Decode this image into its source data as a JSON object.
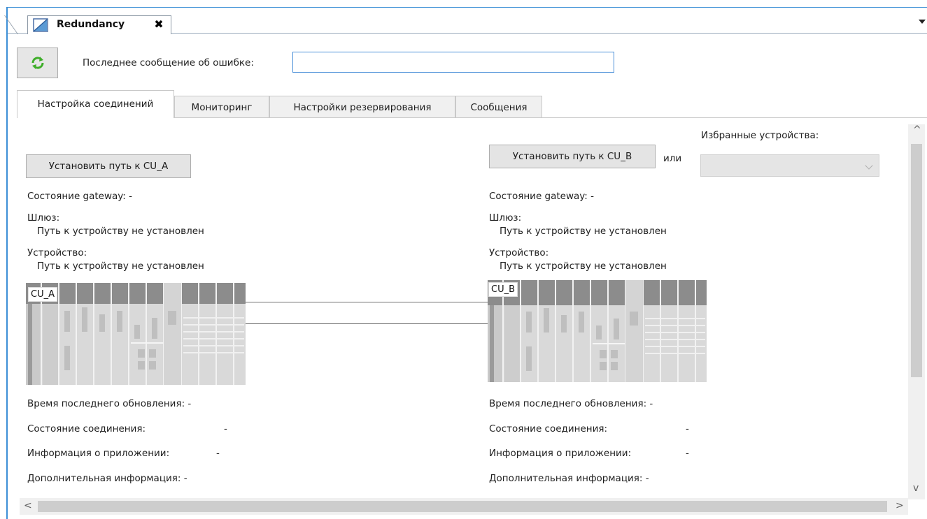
{
  "doc_tab": {
    "title": "Redundancy",
    "close_glyph": "✖",
    "icon": "redundancy-doc-icon"
  },
  "toolbar": {
    "refresh_icon": "refresh-icon",
    "error_label": "Последнее сообщение об ошибке:",
    "error_value": ""
  },
  "tabs": [
    {
      "label": "Настройка соединений",
      "active": true
    },
    {
      "label": "Мониторинг",
      "active": false
    },
    {
      "label": "Настройки резервирования",
      "active": false
    },
    {
      "label": "Сообщения",
      "active": false
    }
  ],
  "left": {
    "set_path_button": "Установить путь к CU_A",
    "gateway_state": "Состояние gateway:  -",
    "gateway_label": "Шлюз:",
    "gateway_path": "Путь к устройству не установлен",
    "device_label": "Устройство:",
    "device_path": "Путь к устройству не установлен",
    "cu_label": "CU_A",
    "last_update": "Время последнего обновления:  -",
    "connection_state": "Состояние соединения:",
    "connection_state_value": "-",
    "app_info": "Информация о приложении:",
    "app_info_value": "-",
    "extra_info": "Дополнительная информация:  -"
  },
  "right": {
    "set_path_button": "Установить путь к CU_B",
    "or_label": "или",
    "favorites_label": "Избранные устройства:",
    "favorites_value": "",
    "gateway_state": "Состояние gateway:  -",
    "gateway_label": "Шлюз:",
    "gateway_path": "Путь к устройству не установлен",
    "device_label": "Устройство:",
    "device_path": "Путь к устройству не установлен",
    "cu_label": "CU_B",
    "last_update": "Время последнего обновления:  -",
    "connection_state": "Состояние соединения:",
    "connection_state_value": "-",
    "app_info": "Информация о приложении:",
    "app_info_value": "-",
    "extra_info": "Дополнительная информация:  -"
  },
  "scroll": {
    "up": "^",
    "down": "v",
    "left": "<",
    "right": ">"
  },
  "colors": {
    "accent": "#3c8fd6",
    "refresh_green": "#3fae2a",
    "plc_dark": "#8c8c8c",
    "plc_light": "#d6d6d6"
  }
}
